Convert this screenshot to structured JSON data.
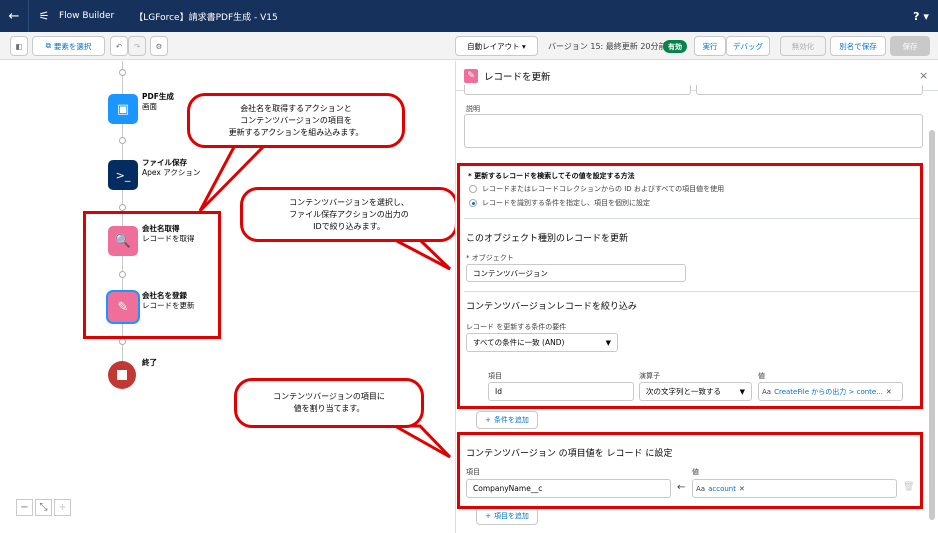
{
  "topbar": {
    "back_icon": "←",
    "app_icon": "⚟",
    "app_name": "Flow Builder",
    "flow_title": "【LGForce】請求書PDF生成 - V15",
    "help": "? ▾"
  },
  "toolbar": {
    "select_elements": "要素を選択",
    "undo": "↶",
    "redo": "↷",
    "settings": "⚙",
    "layout_select": "自動レイアウト  ▾",
    "version_text": "バージョン 15: 最終更新 20分前",
    "status_badge": "有効",
    "run": "実行",
    "debug": "デバッグ",
    "deactivate": "無効化",
    "save_as": "別名で保存",
    "save": "保存"
  },
  "canvas": {
    "nodes": [
      {
        "title": "PDF生成",
        "subtitle": "画面",
        "icon": "▣"
      },
      {
        "title": "ファイル保存",
        "subtitle": "Apex アクション",
        "icon": ">_"
      },
      {
        "title": "会社名取得",
        "subtitle": "レコードを取得",
        "icon": "🔍"
      },
      {
        "title": "会社名を登録",
        "subtitle": "レコードを更新",
        "icon": "✎"
      },
      {
        "title": "終了",
        "subtitle": ""
      }
    ],
    "callouts": [
      {
        "lines": [
          "会社名を取得するアクションと",
          "コンテンツバージョンの項目を",
          "更新するアクションを組み込みます。"
        ]
      },
      {
        "lines": [
          "コンテンツバージョンを選択し、",
          "ファイル保存アクションの出力の",
          "IDで絞り込みます。"
        ]
      },
      {
        "lines": [
          "コンテンツバージョンの項目に",
          "値を割り当てます。"
        ]
      }
    ],
    "zoom": {
      "out": "−",
      "fit": "⤡",
      "in": "+"
    }
  },
  "panel": {
    "title": "レコードを更新",
    "close": "×",
    "description_label": "説明",
    "method_label": "* 更新するレコードを検索してその値を設定する方法",
    "method_options": [
      {
        "label": "レコードまたはレコードコレクションからの ID およびすべての項目値を使用",
        "selected": false
      },
      {
        "label": "レコードを識別する条件を指定し、項目を個別に設定",
        "selected": true
      }
    ],
    "object_section_title": "このオブジェクト種別のレコードを更新",
    "object_label": "* オブジェクト",
    "object_value": "コンテンツバージョン",
    "filter_section_title": "コンテンツバージョンレコードを絞り込み",
    "condition_req_label": "レコード を更新する条件の要件",
    "condition_req_value": "すべての条件に一致 (AND)",
    "filter_row": {
      "field_label": "項目",
      "field_value": "Id",
      "operator_label": "演算子",
      "operator_value": "次の文字列と一致する",
      "value_label": "値",
      "value_value": "CreateFile からの出力 > conte..."
    },
    "add_condition": "条件を追加",
    "set_section_title": "コンテンツバージョン の項目値を レコード に設定",
    "set_row": {
      "field_label": "項目",
      "field_value": "CompanyName__c",
      "value_label": "値",
      "value_value": "account"
    },
    "add_field": "項目を追加"
  }
}
